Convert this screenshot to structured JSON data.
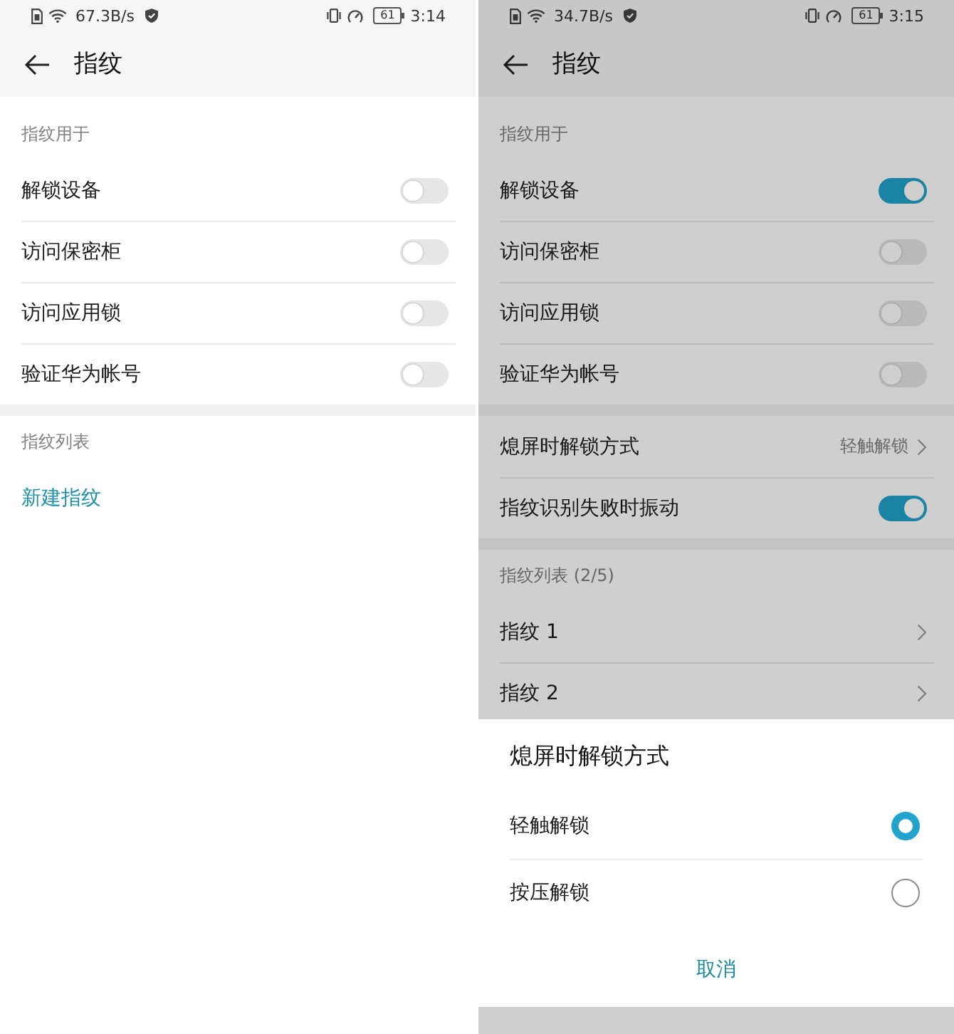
{
  "screens": [
    {
      "status_bar": {
        "network_speed": "67.3B/s",
        "battery": "61",
        "time": "3:14"
      },
      "header": {
        "title": "指纹"
      },
      "sections": [
        {
          "title": "指纹用于",
          "items": [
            {
              "kind": "toggle",
              "label": "解锁设备",
              "on": false
            },
            {
              "kind": "toggle",
              "label": "访问保密柜",
              "on": false
            },
            {
              "kind": "toggle",
              "label": "访问应用锁",
              "on": false
            },
            {
              "kind": "toggle",
              "label": "验证华为帐号",
              "on": false
            }
          ]
        },
        {
          "title": "指纹列表",
          "items": [
            {
              "kind": "link",
              "label": "新建指纹"
            }
          ]
        }
      ]
    },
    {
      "status_bar": {
        "network_speed": "34.7B/s",
        "battery": "61",
        "time": "3:15"
      },
      "header": {
        "title": "指纹"
      },
      "sections": [
        {
          "title": "指纹用于",
          "items": [
            {
              "kind": "toggle",
              "label": "解锁设备",
              "on": true
            },
            {
              "kind": "toggle",
              "label": "访问保密柜",
              "on": false
            },
            {
              "kind": "toggle",
              "label": "访问应用锁",
              "on": false
            },
            {
              "kind": "toggle",
              "label": "验证华为帐号",
              "on": false
            }
          ]
        },
        {
          "items": [
            {
              "kind": "value",
              "label": "熄屏时解锁方式",
              "value": "轻触解锁"
            },
            {
              "kind": "toggle",
              "label": "指纹识别失败时振动",
              "on": true
            }
          ]
        },
        {
          "title": "指纹列表 (2/5)",
          "items": [
            {
              "kind": "nav",
              "label": "指纹 1"
            },
            {
              "kind": "nav",
              "label": "指纹 2"
            }
          ]
        }
      ],
      "dialog": {
        "title": "熄屏时解锁方式",
        "options": [
          {
            "label": "轻触解锁",
            "selected": true
          },
          {
            "label": "按压解锁",
            "selected": false
          }
        ],
        "cancel": "取消"
      }
    }
  ]
}
